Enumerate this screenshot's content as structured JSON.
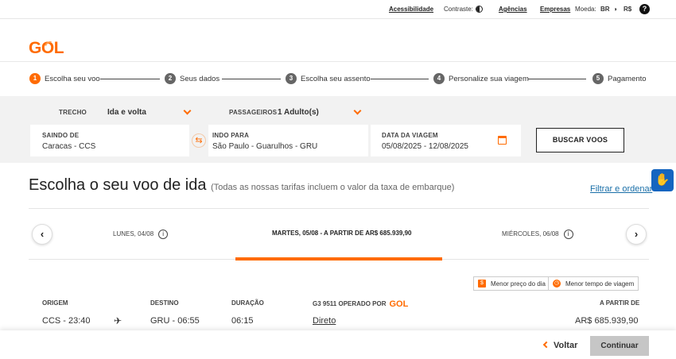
{
  "utility": {
    "accessibility": "Acessibilidade",
    "contrast": "Contraste:",
    "agencies": "Agências",
    "companies": "Empresas",
    "currency_label": "Moeda:",
    "currency_br": "BR",
    "currency_rs": "R$",
    "help": "?"
  },
  "logo": {
    "text_g": "G",
    "text_o": "O",
    "text_l": "L"
  },
  "steps": [
    {
      "num": "1",
      "label": "Escolha seu voo"
    },
    {
      "num": "2",
      "label": "Seus dados"
    },
    {
      "num": "3",
      "label": "Escolha seu assento"
    },
    {
      "num": "4",
      "label": "Personalize sua viagem"
    },
    {
      "num": "5",
      "label": "Pagamento"
    }
  ],
  "search": {
    "trecho_label": "TRECHO",
    "trecho_value": "Ida e volta",
    "passengers_label": "PASSAGEIROS",
    "passengers_value": "1 Adulto(s)",
    "from_label": "SAINDO DE",
    "from_value": "Caracas - CCS",
    "to_label": "INDO PARA",
    "to_value": "São Paulo  -  Guarulhos - GRU",
    "date_label": "DATA DA VIAGEM",
    "date_value": "05/08/2025  -  12/08/2025",
    "search_button": "BUSCAR VOOS"
  },
  "results": {
    "title": "Escolha o seu voo de ida",
    "subtitle": "(Todas as nossas tarifas incluem o valor da taxa de embarque)",
    "filter_link": "Filtrar e ordenar"
  },
  "dates": {
    "prev": "‹",
    "next": "›",
    "items": [
      {
        "label": "LUNES, 04/08"
      },
      {
        "label": "MARTES, 05/08 - A PARTIR DE AR$ 685.939,90"
      },
      {
        "label": "MIÉRCOLES, 06/08"
      }
    ],
    "info": "i"
  },
  "legend": {
    "lowest_price_symbol": "$",
    "lowest_price": "Menor preço do dia",
    "shortest_time": "Menor tempo de viagem"
  },
  "table": {
    "headers": {
      "origin": "ORIGEM",
      "destination": "DESTINO",
      "duration": "DURAÇÃO",
      "operated": "G3 9511 OPERADO POR",
      "operated_logo": "GOL",
      "price": "A PARTIR DE"
    },
    "rows": [
      {
        "origin": "CCS - 23:40",
        "destination": "GRU - 06:55",
        "duration": "06:15",
        "stops": "Direto",
        "price": "AR$ 685.939,90"
      }
    ]
  },
  "footer": {
    "back": "Voltar",
    "continue": "Continuar"
  },
  "colors": {
    "brand_orange": "#ff6b00",
    "link_blue": "#1a6fa8",
    "accessibility_blue": "#1565c0"
  }
}
